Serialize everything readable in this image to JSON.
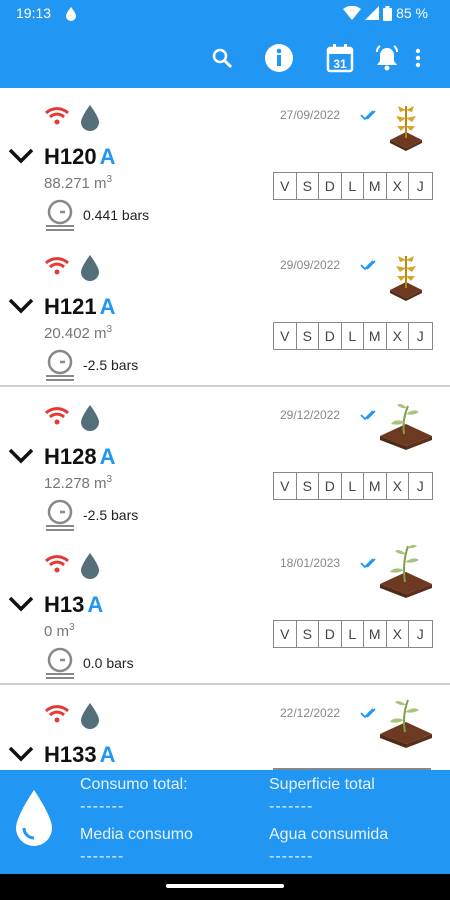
{
  "statusbar": {
    "time": "19:13",
    "battery": "85 %"
  },
  "toolbar": {
    "icons": [
      "search-icon",
      "info-icon",
      "calendar-icon",
      "bell-icon",
      "more-vert-icon"
    ],
    "calendar_day": "31"
  },
  "colors": {
    "primary": "#2196f3",
    "wifi": "#e53935",
    "drop": "#546e7a",
    "tick": "#2196f3"
  },
  "hydrants": [
    {
      "name": "H120",
      "suffix": "A",
      "volume": "88.271 m",
      "unit_sup": "3",
      "pressure": "0.441 bars",
      "date": "27/09/2022",
      "plant": "plant-dry-icon",
      "days": [
        "V",
        "S",
        "D",
        "L",
        "M",
        "X",
        "J"
      ]
    },
    {
      "name": "H121",
      "suffix": "A",
      "volume": "20.402 m",
      "unit_sup": "3",
      "pressure": "-2.5 bars",
      "date": "29/09/2022",
      "plant": "plant-dry-icon",
      "days": [
        "V",
        "S",
        "D",
        "L",
        "M",
        "X",
        "J"
      ]
    },
    {
      "name": "H128",
      "suffix": "A",
      "volume": "12.278 m",
      "unit_sup": "3",
      "pressure": "-2.5 bars",
      "date": "29/12/2022",
      "plant": "plant-green-icon",
      "days": [
        "V",
        "S",
        "D",
        "L",
        "M",
        "X",
        "J"
      ]
    },
    {
      "name": "H13",
      "suffix": "A",
      "volume": "0 m",
      "unit_sup": "3",
      "pressure": "0.0 bars",
      "date": "18/01/2023",
      "plant": "plant-green-icon",
      "days": [
        "V",
        "S",
        "D",
        "L",
        "M",
        "X",
        "J"
      ]
    },
    {
      "name": "H133",
      "suffix": "A",
      "volume": "",
      "unit_sup": "",
      "pressure": "",
      "date": "22/12/2022",
      "plant": "plant-green-icon",
      "days": []
    }
  ],
  "footer": {
    "consumo_total_label": "Consumo total:",
    "consumo_total_value": "-------",
    "superficie_total_label": "Superficie total",
    "superficie_total_value": "-------",
    "media_consumo_label": "Media consumo",
    "media_consumo_value": "-------",
    "agua_consumida_label": "Agua consumida",
    "agua_consumida_value": "-------"
  }
}
